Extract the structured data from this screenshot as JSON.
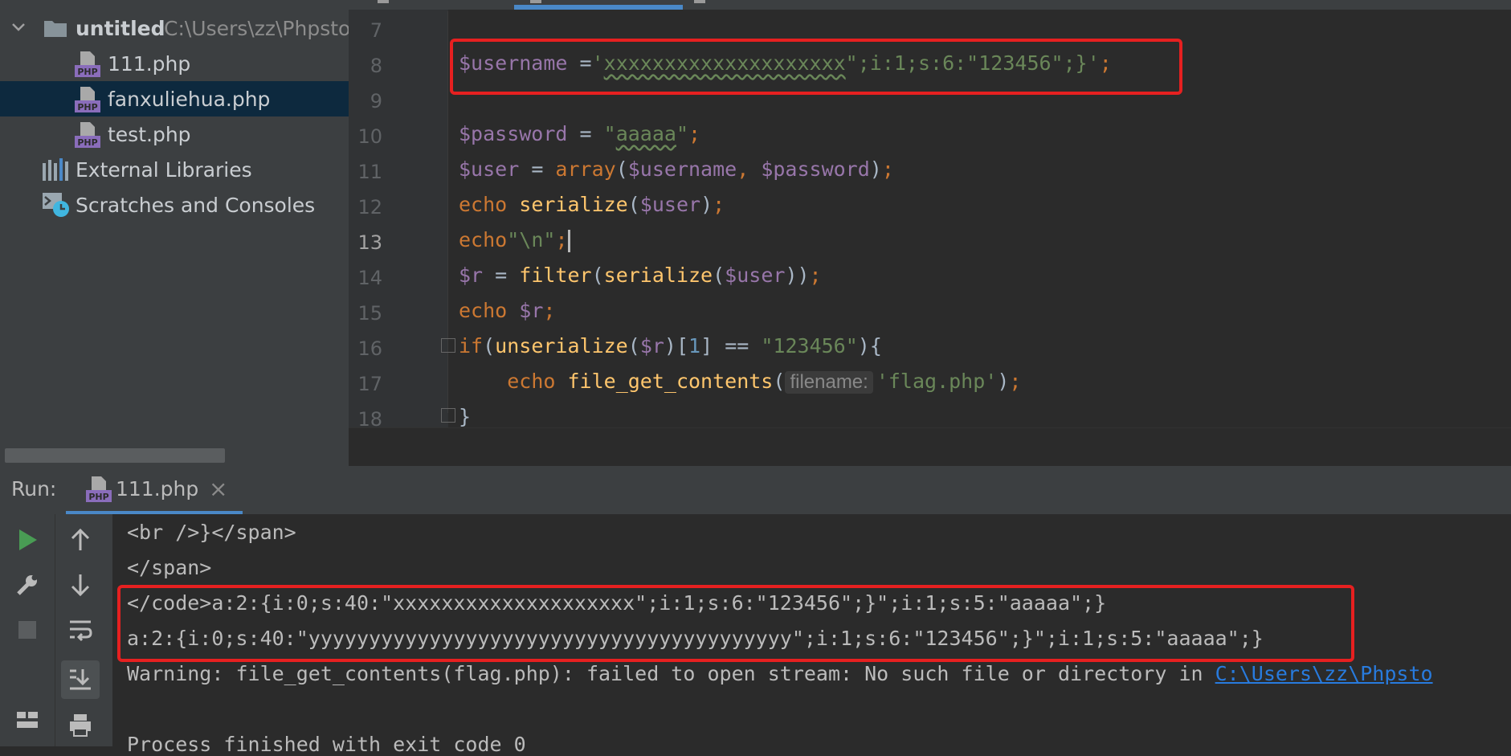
{
  "project": {
    "root_name": "untitled",
    "root_path": "C:\\Users\\zz\\Phpsto",
    "files": [
      {
        "name": "111.php",
        "icon": "php-file-icon",
        "selected": false
      },
      {
        "name": "fanxuliehua.php",
        "icon": "php-file-icon",
        "selected": true
      },
      {
        "name": "test.php",
        "icon": "php-file-icon",
        "selected": false
      }
    ],
    "external_libraries": "External Libraries",
    "scratches": "Scratches and Consoles"
  },
  "editor": {
    "line_numbers": [
      "7",
      "8",
      "9",
      "10",
      "11",
      "12",
      "13",
      "14",
      "15",
      "16",
      "17",
      "18"
    ],
    "current_line": "13",
    "code": {
      "l8_var": "$username",
      "l8_op": " =",
      "l8_q1": "'",
      "l8_xs": "xxxxxxxxxxxxxxxxxxxx",
      "l8_rest": "\";i:1;s:6:\"123456\";}'",
      "l8_semi": ";",
      "l10_var": "$password",
      "l10_op": " = ",
      "l10_q1": "\"",
      "l10_val": "aaaaa",
      "l10_q2": "\"",
      "l10_semi": ";",
      "l11_var": "$user",
      "l11_op": " = ",
      "l11_fn": "array",
      "l11_p1": "(",
      "l11_a1": "$username",
      "l11_comma": ", ",
      "l11_a2": "$password",
      "l11_p2": ")",
      "l11_semi": ";",
      "l12_kw": "echo",
      "l12_fn": " serialize",
      "l12_p1": "(",
      "l12_a": "$user",
      "l12_p2": ")",
      "l12_semi": ";",
      "l13_kw": "echo",
      "l13_str": "\"\\n\"",
      "l13_semi": ";",
      "l14_var": "$r",
      "l14_op": " = ",
      "l14_fn1": "filter",
      "l14_p1": "(",
      "l14_fn2": "serialize",
      "l14_p2": "(",
      "l14_a": "$user",
      "l14_p3": "))",
      "l14_semi": ";",
      "l15_kw": "echo",
      "l15_var": " $r",
      "l15_semi": ";",
      "l16_kw": "if",
      "l16_p1": "(",
      "l16_fn": "unserialize",
      "l16_p2": "(",
      "l16_var": "$r",
      "l16_p3": ")[",
      "l16_num": "1",
      "l16_p4": "] == ",
      "l16_str": "\"123456\"",
      "l16_p5": "){",
      "l17_indent": "    ",
      "l17_kw": "echo",
      "l17_fn": " file_get_contents",
      "l17_p1": "(",
      "l17_hint": "filename:",
      "l17_str": "'flag.php'",
      "l17_p2": ")",
      "l17_semi": ";",
      "l18": "}"
    }
  },
  "run": {
    "title": "Run:",
    "tab_label": "111.php",
    "close_glyph": "×",
    "output": [
      "<br />}</span>",
      "</span>",
      "</code>a:2:{i:0;s:40:\"xxxxxxxxxxxxxxxxxxxx\";i:1;s:6:\"123456\";}\";i:1;s:5:\"aaaaa\";}",
      "a:2:{i:0;s:40:\"yyyyyyyyyyyyyyyyyyyyyyyyyyyyyyyyyyyyyyyy\";i:1;s:6:\"123456\";}\";i:1;s:5:\"aaaaa\";}"
    ],
    "warning_text": "Warning: file_get_contents(flag.php): failed to open stream: No such file or directory in ",
    "warning_link": "C:\\Users\\zz\\Phpsto",
    "finished": "Process finished with exit code 0",
    "tools": [
      "run-icon",
      "up-arrow-icon",
      "wrench-icon",
      "down-arrow-icon",
      "stop-icon",
      "soft-wrap-icon",
      "scroll-to-end-icon",
      "layout-icon",
      "print-icon"
    ]
  },
  "colors": {
    "highlight_box": "#e62020",
    "variable": "#9876aa",
    "string": "#6a8759",
    "keyword": "#cc7832",
    "function": "#ffc66d",
    "number": "#6897bb",
    "link": "#287bde"
  }
}
